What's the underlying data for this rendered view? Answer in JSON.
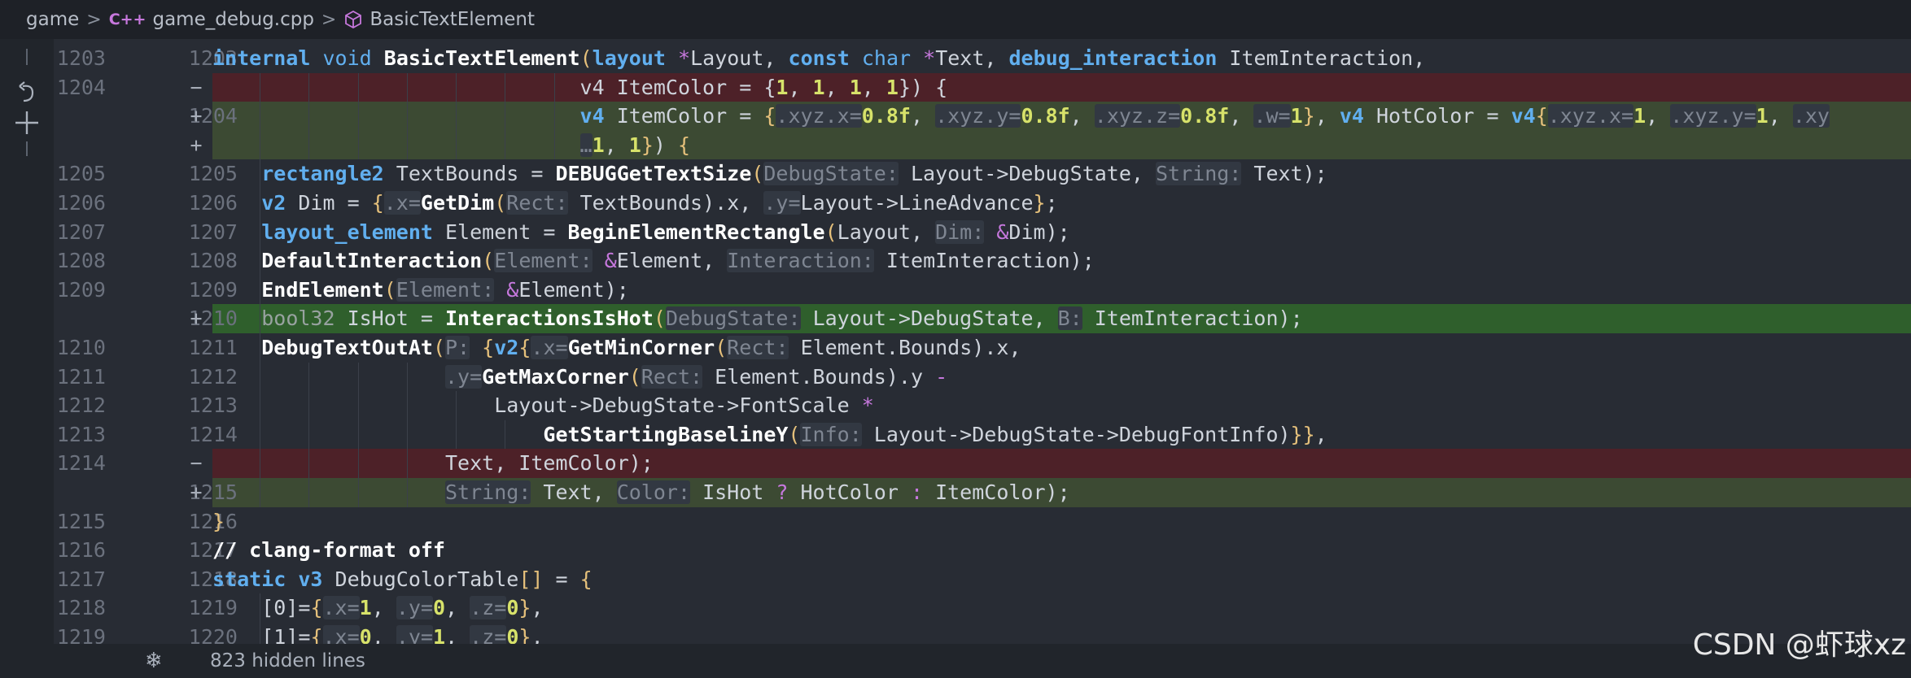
{
  "breadcrumb": {
    "items": [
      "game",
      "game_debug.cpp",
      "BasicTextElement"
    ],
    "file_icon": "cpp-file-icon",
    "symbol_icon": "cube-icon"
  },
  "gutter_strip": {
    "icons": [
      "undo-icon",
      "add-icon"
    ]
  },
  "colors": {
    "background": "#282c34",
    "deleted_line": "#4d2128",
    "added_line": "#3c4a33",
    "added_line_strong": "#2f5f2c",
    "keyword": "#61afef",
    "function": "#ffffff",
    "text": "#cfd4dc",
    "number": "#d7e26a",
    "bracket": "#e5c07b",
    "hint": "#7f8692",
    "hint_bg": "#323842",
    "line_number": "#6b717d"
  },
  "lines": [
    {
      "type": "ctx",
      "old": "1203",
      "new": "1203",
      "mark": "",
      "indent": "",
      "tokens": [
        {
          "t": "internal",
          "c": "kwb"
        },
        {
          "t": " "
        },
        {
          "t": "void",
          "c": "kw"
        },
        {
          "t": " "
        },
        {
          "t": "BasicTextElement",
          "c": "fn"
        },
        {
          "t": "(",
          "c": "br"
        },
        {
          "t": "layout",
          "c": "kwb"
        },
        {
          "t": " "
        },
        {
          "t": "*",
          "c": "op"
        },
        {
          "t": "Layout, "
        },
        {
          "t": "const",
          "c": "kwb"
        },
        {
          "t": " "
        },
        {
          "t": "char",
          "c": "kw"
        },
        {
          "t": " "
        },
        {
          "t": "*",
          "c": "op"
        },
        {
          "t": "Text, "
        },
        {
          "t": "debug_interaction",
          "c": "kwb"
        },
        {
          "t": " ItemInteraction,"
        }
      ]
    },
    {
      "type": "del",
      "old": "1204",
      "new": "",
      "mark": "−",
      "indent": "                              ",
      "tokens": [
        {
          "t": "v4 ItemColor = {"
        },
        {
          "t": "1",
          "c": "num"
        },
        {
          "t": ", "
        },
        {
          "t": "1",
          "c": "num"
        },
        {
          "t": ", "
        },
        {
          "t": "1",
          "c": "num"
        },
        {
          "t": ", "
        },
        {
          "t": "1",
          "c": "num"
        },
        {
          "t": "}) {"
        }
      ]
    },
    {
      "type": "add",
      "old": "",
      "new": "1204",
      "mark": "+",
      "indent": "                              ",
      "tokens": [
        {
          "t": "v4",
          "c": "kwb"
        },
        {
          "t": " ItemColor = "
        },
        {
          "t": "{",
          "c": "br"
        },
        {
          "t": ".xyz.x=",
          "c": "hint"
        },
        {
          "t": "0.8f",
          "c": "num"
        },
        {
          "t": ", "
        },
        {
          "t": ".xyz.y=",
          "c": "hint"
        },
        {
          "t": "0.8f",
          "c": "num"
        },
        {
          "t": ", "
        },
        {
          "t": ".xyz.z=",
          "c": "hint"
        },
        {
          "t": "0.8f",
          "c": "num"
        },
        {
          "t": ", "
        },
        {
          "t": ".w=",
          "c": "hint"
        },
        {
          "t": "1",
          "c": "num"
        },
        {
          "t": "}",
          "c": "br"
        },
        {
          "t": ", "
        },
        {
          "t": "v4",
          "c": "kwb"
        },
        {
          "t": " HotColor = "
        },
        {
          "t": "v4",
          "c": "kwb"
        },
        {
          "t": "{",
          "c": "br"
        },
        {
          "t": ".xyz.x=",
          "c": "hint"
        },
        {
          "t": "1",
          "c": "num"
        },
        {
          "t": ", "
        },
        {
          "t": ".xyz.y=",
          "c": "hint"
        },
        {
          "t": "1",
          "c": "num"
        },
        {
          "t": ", "
        },
        {
          "t": ".xy",
          "c": "hint"
        }
      ]
    },
    {
      "type": "add",
      "old": "",
      "new": "",
      "mark": "+",
      "indent": "                              ",
      "tokens": [
        {
          "t": "…",
          "c": "hint"
        },
        {
          "t": "1",
          "c": "num"
        },
        {
          "t": ", "
        },
        {
          "t": "1",
          "c": "num"
        },
        {
          "t": "}",
          "c": "br"
        },
        {
          "t": ") "
        },
        {
          "t": "{",
          "c": "br"
        }
      ]
    },
    {
      "type": "ctx",
      "old": "1205",
      "new": "1205",
      "mark": "",
      "indent": "    ",
      "tokens": [
        {
          "t": "rectangle2",
          "c": "kwb"
        },
        {
          "t": " TextBounds = "
        },
        {
          "t": "DEBUGGetTextSize",
          "c": "fn"
        },
        {
          "t": "(",
          "c": "br"
        },
        {
          "t": "DebugState:",
          "c": "hint"
        },
        {
          "t": " Layout->DebugState, "
        },
        {
          "t": "String:",
          "c": "hint"
        },
        {
          "t": " Text);"
        }
      ]
    },
    {
      "type": "ctx",
      "old": "1206",
      "new": "1206",
      "mark": "",
      "indent": "    ",
      "tokens": [
        {
          "t": "v2",
          "c": "kwb"
        },
        {
          "t": " Dim = "
        },
        {
          "t": "{",
          "c": "br"
        },
        {
          "t": ".x=",
          "c": "hint"
        },
        {
          "t": "GetDim",
          "c": "fn"
        },
        {
          "t": "(",
          "c": "br"
        },
        {
          "t": "Rect:",
          "c": "hint"
        },
        {
          "t": " TextBounds).x, "
        },
        {
          "t": ".y=",
          "c": "hint"
        },
        {
          "t": "Layout->LineAdvance"
        },
        {
          "t": "}",
          "c": "br"
        },
        {
          "t": ";"
        }
      ]
    },
    {
      "type": "ctx",
      "old": "1207",
      "new": "1207",
      "mark": "",
      "indent": "    ",
      "tokens": [
        {
          "t": "layout_element",
          "c": "kwb"
        },
        {
          "t": " Element = "
        },
        {
          "t": "BeginElementRectangle",
          "c": "fn"
        },
        {
          "t": "(",
          "c": "br"
        },
        {
          "t": "Layout, "
        },
        {
          "t": "Dim:",
          "c": "hint"
        },
        {
          "t": " "
        },
        {
          "t": "&",
          "c": "op"
        },
        {
          "t": "Dim);"
        }
      ]
    },
    {
      "type": "ctx",
      "old": "1208",
      "new": "1208",
      "mark": "",
      "indent": "    ",
      "tokens": [
        {
          "t": "DefaultInteraction",
          "c": "fn"
        },
        {
          "t": "(",
          "c": "br"
        },
        {
          "t": "Element:",
          "c": "hint"
        },
        {
          "t": " "
        },
        {
          "t": "&",
          "c": "op"
        },
        {
          "t": "Element, "
        },
        {
          "t": "Interaction:",
          "c": "hint"
        },
        {
          "t": " ItemInteraction);"
        }
      ]
    },
    {
      "type": "ctx",
      "old": "1209",
      "new": "1209",
      "mark": "",
      "indent": "    ",
      "tokens": [
        {
          "t": "EndElement",
          "c": "fn"
        },
        {
          "t": "(",
          "c": "br"
        },
        {
          "t": "Element:",
          "c": "hint"
        },
        {
          "t": " "
        },
        {
          "t": "&",
          "c": "op"
        },
        {
          "t": "Element);"
        }
      ]
    },
    {
      "type": "addstrong",
      "old": "",
      "new": "1210",
      "mark": "+",
      "indent": "    ",
      "tokens": [
        {
          "t": "bool32",
          "c": "dim"
        },
        {
          "t": " IsHot = "
        },
        {
          "t": "InteractionsIsHot",
          "c": "fn"
        },
        {
          "t": "(",
          "c": "br"
        },
        {
          "t": "DebugState:",
          "c": "hint"
        },
        {
          "t": " Layout->DebugState, "
        },
        {
          "t": "B:",
          "c": "hint"
        },
        {
          "t": " ItemInteraction);"
        }
      ]
    },
    {
      "type": "ctx",
      "old": "1210",
      "new": "1211",
      "mark": "",
      "indent": "    ",
      "tokens": [
        {
          "t": "DebugTextOutAt",
          "c": "fn"
        },
        {
          "t": "(",
          "c": "br"
        },
        {
          "t": "P:",
          "c": "hint"
        },
        {
          "t": " "
        },
        {
          "t": "{",
          "c": "br"
        },
        {
          "t": "v2",
          "c": "kwb"
        },
        {
          "t": "{",
          "c": "br"
        },
        {
          "t": ".x=",
          "c": "hint"
        },
        {
          "t": "GetMinCorner",
          "c": "fn"
        },
        {
          "t": "(",
          "c": "br"
        },
        {
          "t": "Rect:",
          "c": "hint"
        },
        {
          "t": " Element.Bounds).x,"
        }
      ]
    },
    {
      "type": "ctx",
      "old": "1211",
      "new": "1212",
      "mark": "",
      "indent": "                   ",
      "tokens": [
        {
          "t": ".y=",
          "c": "hint"
        },
        {
          "t": "GetMaxCorner",
          "c": "fn"
        },
        {
          "t": "(",
          "c": "br"
        },
        {
          "t": "Rect:",
          "c": "hint"
        },
        {
          "t": " Element.Bounds).y "
        },
        {
          "t": "-",
          "c": "op"
        }
      ]
    },
    {
      "type": "ctx",
      "old": "1212",
      "new": "1213",
      "mark": "",
      "indent": "                       ",
      "tokens": [
        {
          "t": "Layout->DebugState->FontScale "
        },
        {
          "t": "*",
          "c": "op"
        }
      ]
    },
    {
      "type": "ctx",
      "old": "1213",
      "new": "1214",
      "mark": "",
      "indent": "                           ",
      "tokens": [
        {
          "t": "GetStartingBaselineY",
          "c": "fn"
        },
        {
          "t": "(",
          "c": "br"
        },
        {
          "t": "Info:",
          "c": "hint"
        },
        {
          "t": " Layout->DebugState->DebugFontInfo)"
        },
        {
          "t": "}",
          "c": "br"
        },
        {
          "t": "}",
          "c": "br"
        },
        {
          "t": ","
        }
      ]
    },
    {
      "type": "del",
      "old": "1214",
      "new": "",
      "mark": "−",
      "indent": "                   ",
      "tokens": [
        {
          "t": "Text, ItemColor);"
        }
      ]
    },
    {
      "type": "add",
      "old": "",
      "new": "1215",
      "mark": "+",
      "indent": "                   ",
      "tokens": [
        {
          "t": "String:",
          "c": "hint"
        },
        {
          "t": " Text, "
        },
        {
          "t": "Color:",
          "c": "hint"
        },
        {
          "t": " IsHot "
        },
        {
          "t": "?",
          "c": "op"
        },
        {
          "t": " HotColor "
        },
        {
          "t": ":",
          "c": "op"
        },
        {
          "t": " ItemColor);"
        }
      ]
    },
    {
      "type": "ctx",
      "old": "1215",
      "new": "1216",
      "mark": "",
      "indent": "",
      "tokens": [
        {
          "t": "}",
          "c": "br"
        }
      ]
    },
    {
      "type": "ctx",
      "old": "1216",
      "new": "1217",
      "mark": "",
      "indent": "",
      "tokens": [
        {
          "t": "// clang-format off",
          "c": "cmt"
        }
      ]
    },
    {
      "type": "ctx",
      "old": "1217",
      "new": "1218",
      "mark": "",
      "indent": "",
      "tokens": [
        {
          "t": "static",
          "c": "kwb"
        },
        {
          "t": " "
        },
        {
          "t": "v3",
          "c": "kwb"
        },
        {
          "t": " DebugColorTable"
        },
        {
          "t": "[]",
          "c": "br"
        },
        {
          "t": " = "
        },
        {
          "t": "{",
          "c": "br"
        }
      ]
    },
    {
      "type": "ctx",
      "old": "1218",
      "new": "1219",
      "mark": "",
      "indent": "    ",
      "tokens": [
        {
          "t": "[0]="
        },
        {
          "t": "{",
          "c": "br"
        },
        {
          "t": ".x=",
          "c": "hint"
        },
        {
          "t": "1",
          "c": "num"
        },
        {
          "t": ", "
        },
        {
          "t": ".y=",
          "c": "hint"
        },
        {
          "t": "0",
          "c": "num"
        },
        {
          "t": ", "
        },
        {
          "t": ".z=",
          "c": "hint"
        },
        {
          "t": "0",
          "c": "num"
        },
        {
          "t": "}",
          "c": "br"
        },
        {
          "t": ","
        }
      ]
    },
    {
      "type": "ctx",
      "old": "1219",
      "new": "1220",
      "mark": "",
      "indent": "    ",
      "tokens": [
        {
          "t": "[1]="
        },
        {
          "t": "{",
          "c": "br"
        },
        {
          "t": ".x=",
          "c": "hint"
        },
        {
          "t": "0",
          "c": "num"
        },
        {
          "t": ", "
        },
        {
          "t": ".y=",
          "c": "hint"
        },
        {
          "t": "1",
          "c": "num"
        },
        {
          "t": ", "
        },
        {
          "t": ".z=",
          "c": "hint"
        },
        {
          "t": "0",
          "c": "num"
        },
        {
          "t": "}",
          "c": "br"
        },
        {
          "t": ","
        }
      ]
    }
  ],
  "footer": {
    "icon": "fold-icon",
    "text": "823 hidden lines"
  },
  "watermark": "CSDN @虾球xz"
}
